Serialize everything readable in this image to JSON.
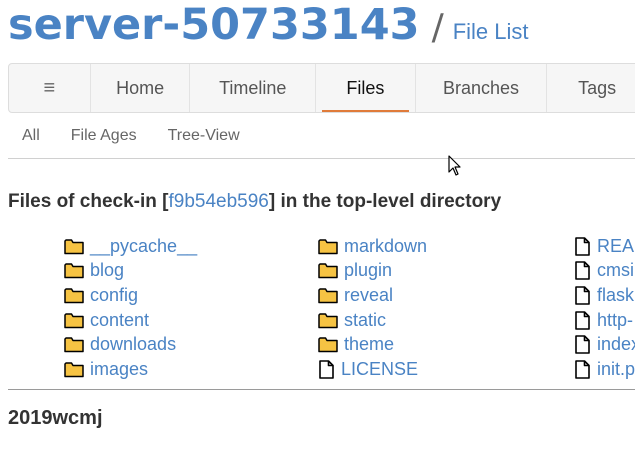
{
  "header": {
    "project": "server-50733143",
    "separator": "/",
    "page_title": "File List"
  },
  "mainmenu": {
    "menu_icon": "≡",
    "items": [
      "Home",
      "Timeline",
      "Files",
      "Branches",
      "Tags"
    ],
    "active": "Files"
  },
  "submenu": {
    "items": [
      "All",
      "File Ages",
      "Tree-View"
    ]
  },
  "heading": {
    "prefix": "Files of check-in [",
    "hash": "f9b54eb596",
    "suffix": "] in the top-level directory"
  },
  "files": {
    "col1": [
      {
        "name": "__pycache__",
        "type": "folder"
      },
      {
        "name": "blog",
        "type": "folder"
      },
      {
        "name": "config",
        "type": "folder"
      },
      {
        "name": "content",
        "type": "folder"
      },
      {
        "name": "downloads",
        "type": "folder"
      },
      {
        "name": "images",
        "type": "folder"
      }
    ],
    "col2": [
      {
        "name": "markdown",
        "type": "folder"
      },
      {
        "name": "plugin",
        "type": "folder"
      },
      {
        "name": "reveal",
        "type": "folder"
      },
      {
        "name": "static",
        "type": "folder"
      },
      {
        "name": "theme",
        "type": "folder"
      },
      {
        "name": "LICENSE",
        "type": "file"
      }
    ],
    "col3": [
      {
        "name": "REA",
        "type": "file"
      },
      {
        "name": "cmsi",
        "type": "file"
      },
      {
        "name": "flask",
        "type": "file"
      },
      {
        "name": "http-",
        "type": "file"
      },
      {
        "name": "index",
        "type": "file"
      },
      {
        "name": "init.p",
        "type": "file"
      }
    ]
  },
  "section": {
    "title": "2019wcmj"
  },
  "icons": {
    "folder": "folder-icon",
    "file": "file-icon",
    "menu": "hamburger-icon",
    "cursor": "mouse-cursor-icon"
  },
  "colors": {
    "link": "#4a83c4",
    "active_underline": "#e07b3a",
    "folder_fill": "#f6c343"
  }
}
